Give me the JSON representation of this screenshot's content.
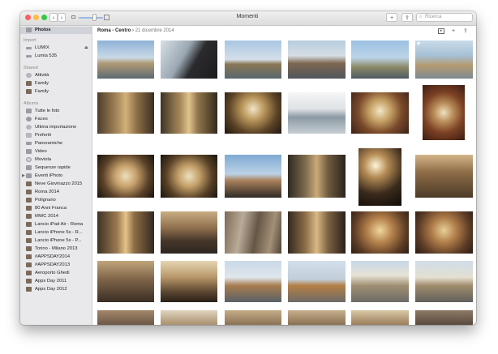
{
  "window": {
    "title": "Momenti",
    "search_placeholder": "Ricerca",
    "add_label": "+",
    "share_label": "⇪"
  },
  "breadcrumb": {
    "place": "Roma - Centro",
    "separator": "›",
    "date": "21 dicembre 2014"
  },
  "sidebar": {
    "top_item": "Photos",
    "sections": {
      "import": "Import",
      "shared": "Shared",
      "albums": "Albums"
    },
    "import_items": [
      "LUMIX",
      "Lumia 535"
    ],
    "shared_items": [
      "Attività",
      "Family",
      "Family"
    ],
    "album_items": [
      "Tutte le foto",
      "Faces",
      "Ultima importazione",
      "Preferiti",
      "Panoramiche",
      "Video",
      "Moviola",
      "Sequenze rapide",
      "Eventi iPhoto",
      "Neve Giovinazzo 2015",
      "Roma 2014",
      "Polignano",
      "80 Anni Franca",
      "MWC 2014",
      "Lancio iPad Air - Roma",
      "Lancio iPhone 5s - R...",
      "Lancio iPhone 5s - P...",
      "Torino - Milano 2013",
      "#APPSDAY2014",
      "#APPSDAY2013",
      "Aeroporto Ghedi",
      "Apps Day 2011",
      "Apps Day 2012"
    ]
  },
  "colors": {
    "sidebar_bg": "#e9e9eb",
    "selected": "#cfd2d8",
    "toolbar_top": "#f0f0f0"
  }
}
